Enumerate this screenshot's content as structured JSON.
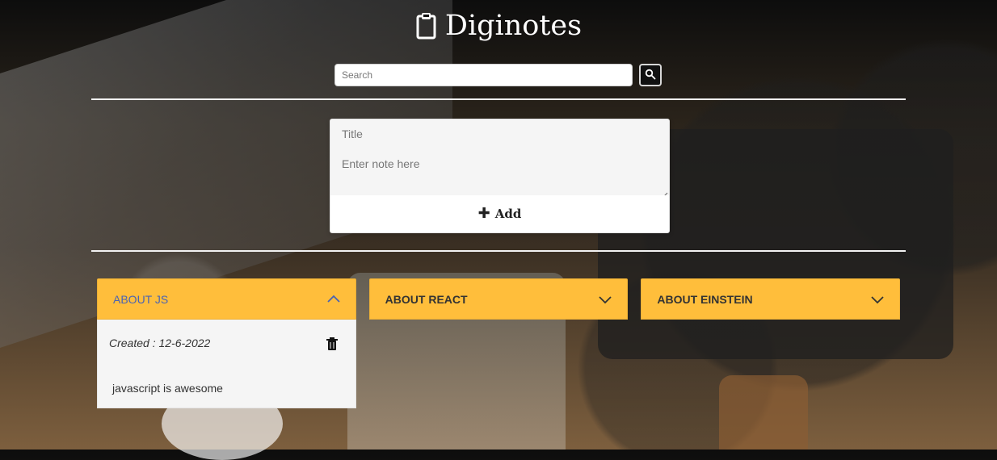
{
  "app": {
    "title": "Diginotes",
    "title_icon": "clipboard-icon"
  },
  "search": {
    "placeholder": "Search",
    "value": "",
    "button_icon": "search-icon"
  },
  "composer": {
    "title_placeholder": "Title",
    "title_value": "",
    "note_placeholder": "Enter note here",
    "note_value": "",
    "add_label": "Add",
    "add_icon": "plus-icon"
  },
  "notes": [
    {
      "title": "ABOUT JS",
      "expanded": true,
      "created_label": "Created : 12-6-2022",
      "body": "javascript is awesome",
      "chevron_icon": "chevron-up-icon",
      "delete_icon": "trash-icon"
    },
    {
      "title": "ABOUT REACT",
      "expanded": false,
      "chevron_icon": "chevron-down-icon"
    },
    {
      "title": "ABOUT EINSTEIN",
      "expanded": false,
      "chevron_icon": "chevron-down-icon"
    }
  ],
  "colors": {
    "accent": "#ffbe3b",
    "link_blue": "#4a63b3",
    "panel_bg": "#f5f5f5"
  }
}
